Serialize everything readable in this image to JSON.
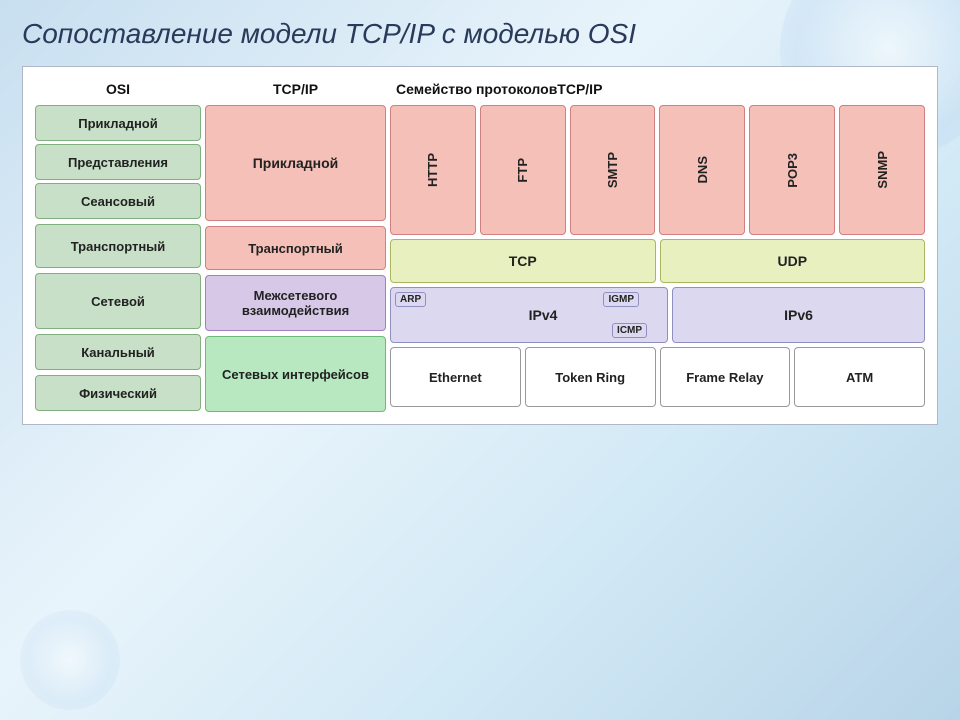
{
  "page": {
    "title": "Сопоставление модели TCP/IP с моделью OSI"
  },
  "columns": {
    "osi_header": "OSI",
    "tcpip_header": "TCP/IP",
    "proto_header": "Семейство протоколовTCP/IP"
  },
  "osi_layers": {
    "application": "Прикладной",
    "presentation": "Представления",
    "session": "Сеансовый",
    "transport": "Транспортный",
    "network": "Сетевой",
    "datalink": "Канальный",
    "physical": "Физический"
  },
  "tcpip_layers": {
    "application": "Прикладной",
    "transport": "Транспортный",
    "network": "Межсетевого взаимодействия",
    "link": "Сетевых интерфейсов"
  },
  "app_protocols": [
    "HTTP",
    "FTP",
    "SMTP",
    "DNS",
    "POP3",
    "SNMP"
  ],
  "transport_protocols": {
    "tcp": "TCP",
    "udp": "UDP"
  },
  "network_protocols": {
    "ipv4": "IPv4",
    "ipv6": "IPv6",
    "arp": "ARP",
    "igmp": "IGMP",
    "icmp": "ICMP"
  },
  "link_protocols": [
    "Ethernet",
    "Token Ring",
    "Frame Relay",
    "ATM"
  ]
}
